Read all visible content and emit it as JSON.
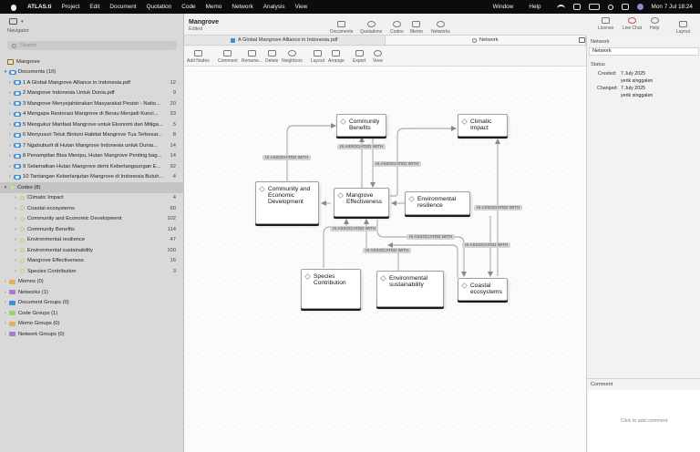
{
  "menubar": {
    "app": "ATLAS.ti",
    "items": [
      "Project",
      "Edit",
      "Document",
      "Quotation",
      "Code",
      "Memo",
      "Network",
      "Analysis",
      "View"
    ],
    "right_items": [
      "Window",
      "Help"
    ],
    "clock": "Mon 7 Jul  18:24"
  },
  "navigator": {
    "title": "Navigator",
    "search_placeholder": "Search",
    "project": "Mangrove",
    "documents_header": "Documents (10)",
    "documents": [
      {
        "label": "1 A Global Mangrove Alliance in Indonesia.pdf",
        "count": "12"
      },
      {
        "label": "2 Mangrove Indonesia Untuk Dunia.pdf",
        "count": "9"
      },
      {
        "label": "3 Mangrove Menyejahterakan Masyarakat Pesisir - Natio...",
        "count": "20"
      },
      {
        "label": "4 Mengapa Restorasi Mangrove di Berau Menjadi Kunci...",
        "count": "33"
      },
      {
        "label": "5 Mengukur Manfaat Mangrove untuk Ekonomi dan Mitiga...",
        "count": "5"
      },
      {
        "label": "6 Menyusuri Teluk Bintuni Habitat Mangrove Tua Terbesar...",
        "count": "8"
      },
      {
        "label": "7 Ngabuburit di Hutan Mangrove Indonesia untuk Dunia...",
        "count": "14"
      },
      {
        "label": "8 Penampilan Bisa Menipu, Hutan Mangrove Penting bag...",
        "count": "14"
      },
      {
        "label": "9 Selamatkan Hutan Mangrove demi Keberlangsungan E...",
        "count": "92"
      },
      {
        "label": "10 Tantangan Keberlanjutan Mangrove di Indonesia Butuh...",
        "count": "4"
      }
    ],
    "codes_header": "Codes (8)",
    "codes": [
      {
        "label": "Climatic Impact",
        "count": "4"
      },
      {
        "label": "Coastal ecosystems",
        "count": "60"
      },
      {
        "label": "Community and Economic Development",
        "count": "102"
      },
      {
        "label": "Community Benefits",
        "count": "114"
      },
      {
        "label": "Environmental resilience",
        "count": "47"
      },
      {
        "label": "Environmental sustainability",
        "count": "100"
      },
      {
        "label": "Mangrove Effectiveness",
        "count": "16"
      },
      {
        "label": "Species Contribution",
        "count": "3"
      }
    ],
    "groups": [
      {
        "label": "Memos (0)",
        "color": "#e0b35a"
      },
      {
        "label": "Networks (1)",
        "color": "#a57cd1"
      },
      {
        "label": "Document Groups (0)",
        "color": "#3d8fd6"
      },
      {
        "label": "Code Groups (1)",
        "color": "#9fd16a"
      },
      {
        "label": "Memo Groups (0)",
        "color": "#e0b35a"
      },
      {
        "label": "Network Groups (0)",
        "color": "#a57cd1"
      }
    ]
  },
  "header": {
    "project_title": "Mangrove",
    "project_status": "Edited",
    "buttons": [
      "Documents",
      "Quotations",
      "Codes",
      "Memo",
      "Networks"
    ],
    "right_buttons": [
      "License",
      "Live Chat",
      "Help"
    ],
    "layout": "Layout"
  },
  "tabs": [
    {
      "label": "A Global Mangrove Alliance in Indonesia.pdf"
    },
    {
      "label": "Network"
    }
  ],
  "subtoolbar": [
    "Add Nodes",
    "Comment",
    "Rename...",
    "Delete",
    "Neighbors",
    "Layout",
    "Arrange",
    "Export",
    "View"
  ],
  "network": {
    "nodes": {
      "community_benefits": "Community Benefits",
      "climatic_impact": "Climatic Impact",
      "community_econ": "Community and Economic Development",
      "mangrove_eff": "Mangrove Effectiveness",
      "env_resilience": "Environmental resilience",
      "species": "Species Contribution",
      "env_sust": "Environmental sustainability",
      "coastal": "Coastal ecosystems"
    },
    "edge_label": "IS ASSOCIATED WITH"
  },
  "inspector": {
    "section_title": "Network",
    "name_value": "Network",
    "status_title": "Status",
    "created_label": "Created:",
    "created_date": "7 July 2025",
    "created_user": "yerik singgalen",
    "changed_label": "Changed:",
    "changed_date": "7 July 2025",
    "changed_user": "yerik singgalen",
    "comment_title": "Comment",
    "comment_placeholder": "Click to add comment"
  }
}
